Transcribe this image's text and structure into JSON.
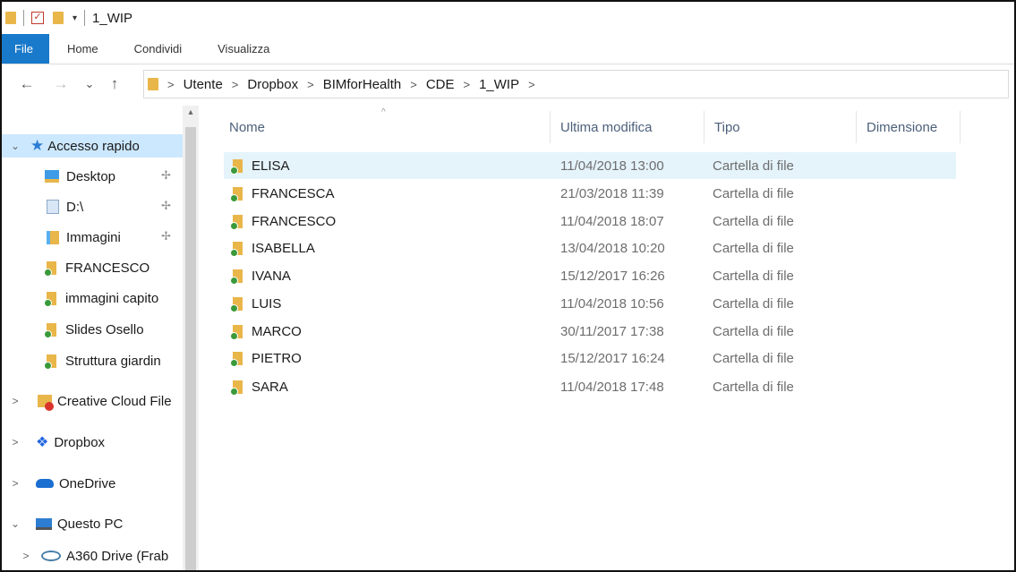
{
  "titlebar": {
    "title": "1_WIP",
    "qa_arrow": "▾"
  },
  "ribbon": {
    "tabs": [
      "File",
      "Home",
      "Condividi",
      "Visualizza"
    ]
  },
  "nav": {
    "back": "←",
    "forward": "→",
    "recent": "⌄",
    "up": "↑",
    "breadcrumb": [
      "Utente",
      "Dropbox",
      "BIMforHealth",
      "CDE",
      "1_WIP"
    ],
    "crumb_sep": ">"
  },
  "sidebar": {
    "items": [
      {
        "label": "Accesso rapido",
        "chevron": "⌄",
        "icon": "star-icon"
      },
      {
        "label": "Desktop",
        "pin": "✢",
        "icon": "desktop-icon"
      },
      {
        "label": "D:\\",
        "pin": "✢",
        "icon": "drive-icon"
      },
      {
        "label": "Immagini",
        "pin": "✢",
        "icon": "pictures-icon"
      },
      {
        "label": "FRANCESCO",
        "icon": "folder-icon"
      },
      {
        "label": "immagini capito",
        "icon": "folder-icon"
      },
      {
        "label": "Slides Osello",
        "icon": "folder-icon"
      },
      {
        "label": "Struttura giardin",
        "icon": "folder-icon"
      },
      {
        "label": "Creative Cloud File",
        "chevron": ">",
        "icon": "creative-cloud-icon"
      },
      {
        "label": "Dropbox",
        "chevron": ">",
        "icon": "dropbox-icon"
      },
      {
        "label": "OneDrive",
        "chevron": ">",
        "icon": "onedrive-icon"
      },
      {
        "label": "Questo PC",
        "chevron": "⌄",
        "icon": "pc-icon"
      },
      {
        "label": "A360 Drive (Frab",
        "chevron": ">",
        "icon": "a360-icon"
      }
    ],
    "scroll_up": "▴"
  },
  "columns": {
    "name": "Nome",
    "modified": "Ultima modifica",
    "type": "Tipo",
    "size": "Dimensione",
    "sort_caret": "^"
  },
  "files": [
    {
      "name": "ELISA",
      "modified": "11/04/2018 13:00",
      "type": "Cartella di file"
    },
    {
      "name": "FRANCESCA",
      "modified": "21/03/2018 11:39",
      "type": "Cartella di file"
    },
    {
      "name": "FRANCESCO",
      "modified": "11/04/2018 18:07",
      "type": "Cartella di file"
    },
    {
      "name": "ISABELLA",
      "modified": "13/04/2018 10:20",
      "type": "Cartella di file"
    },
    {
      "name": "IVANA",
      "modified": "15/12/2017 16:26",
      "type": "Cartella di file"
    },
    {
      "name": "LUIS",
      "modified": "11/04/2018 10:56",
      "type": "Cartella di file"
    },
    {
      "name": "MARCO",
      "modified": "30/11/2017 17:38",
      "type": "Cartella di file"
    },
    {
      "name": "PIETRO",
      "modified": "15/12/2017 16:24",
      "type": "Cartella di file"
    },
    {
      "name": "SARA",
      "modified": "11/04/2018 17:48",
      "type": "Cartella di file"
    }
  ],
  "colors": {
    "accent": "#1979ca",
    "selection": "#cce8ff",
    "folder": "#e9b64a"
  }
}
